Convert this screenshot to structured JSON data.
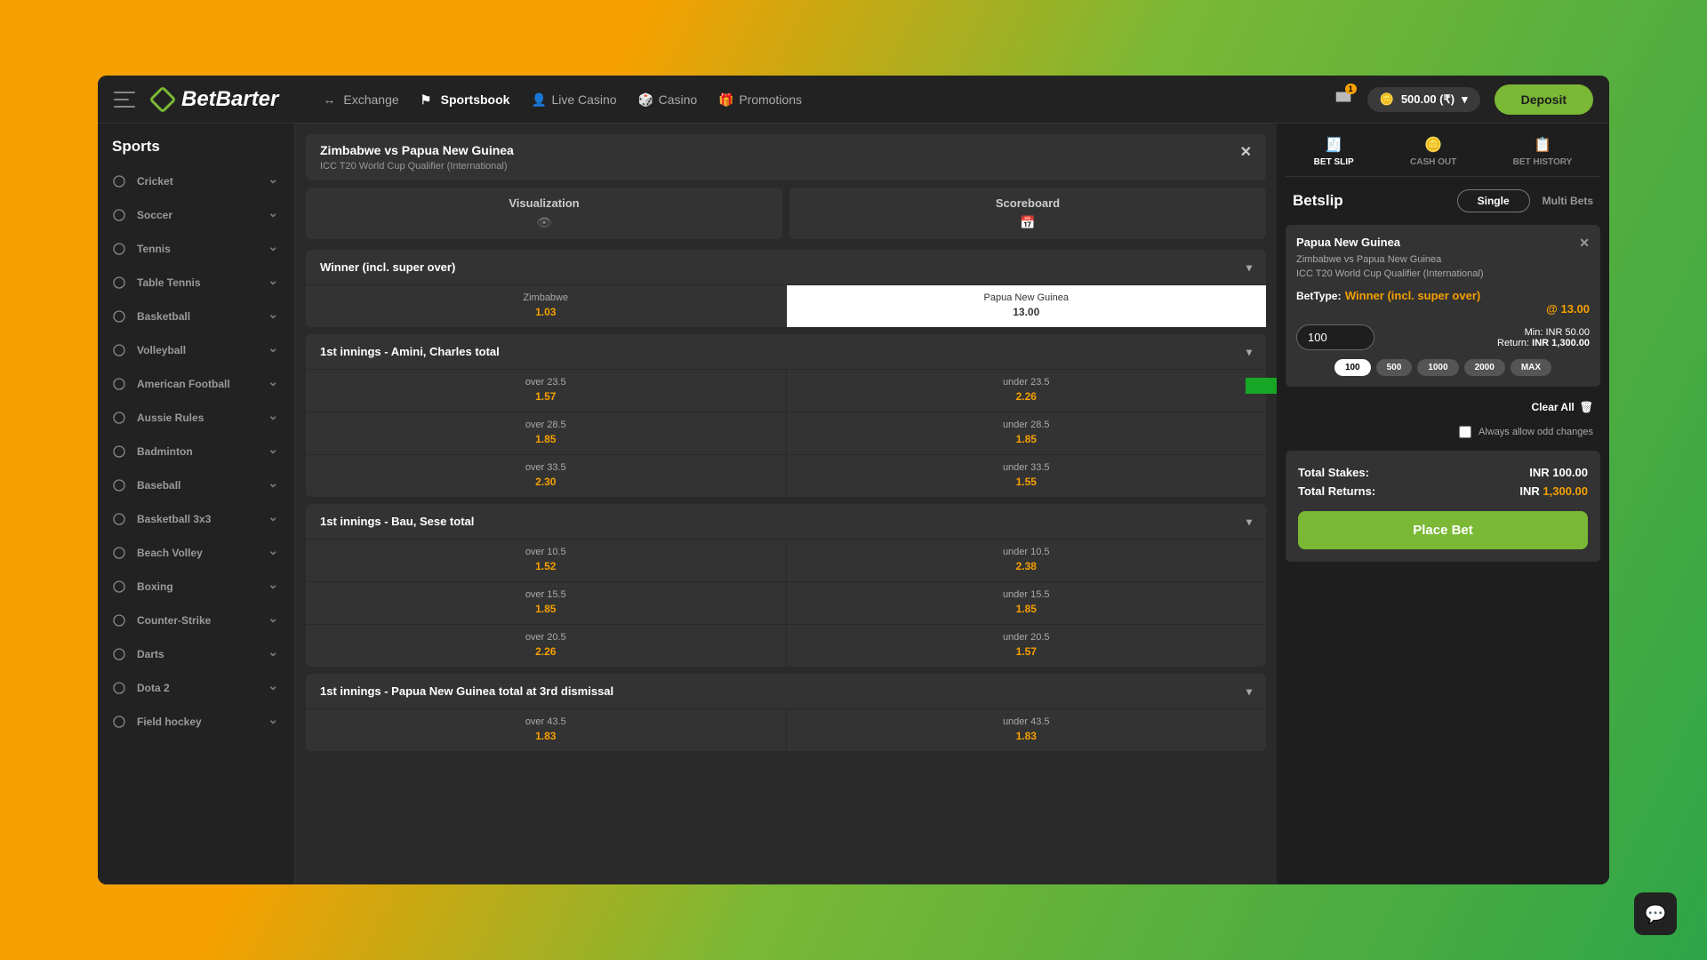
{
  "header": {
    "brand": "BetBarter",
    "nav": [
      {
        "label": "Exchange",
        "icon": "↔"
      },
      {
        "label": "Sportsbook",
        "icon": "⚑",
        "active": true
      },
      {
        "label": "Live Casino",
        "icon": "👤"
      },
      {
        "label": "Casino",
        "icon": "🎲"
      },
      {
        "label": "Promotions",
        "icon": "🎁"
      }
    ],
    "notif_count": "1",
    "balance": "500.00 (₹)",
    "deposit": "Deposit"
  },
  "sidebar": {
    "title": "Sports",
    "items": [
      "Cricket",
      "Soccer",
      "Tennis",
      "Table Tennis",
      "Basketball",
      "Volleyball",
      "American Football",
      "Aussie Rules",
      "Badminton",
      "Baseball",
      "Basketball 3x3",
      "Beach Volley",
      "Boxing",
      "Counter-Strike",
      "Darts",
      "Dota 2",
      "Field hockey"
    ]
  },
  "event": {
    "title": "Zimbabwe vs Papua New Guinea",
    "sub": "ICC T20 World Cup Qualifier (International)",
    "view_tabs": [
      "Visualization",
      "Scoreboard"
    ]
  },
  "markets": [
    {
      "title": "Winner (incl. super over)",
      "rows": [
        [
          {
            "name": "Zimbabwe",
            "val": "1.03"
          },
          {
            "name": "Papua New Guinea",
            "val": "13.00",
            "selected": true
          }
        ]
      ]
    },
    {
      "title": "1st innings - Amini, Charles total",
      "rows": [
        [
          {
            "name": "over 23.5",
            "val": "1.57"
          },
          {
            "name": "under 23.5",
            "val": "2.26"
          }
        ],
        [
          {
            "name": "over 28.5",
            "val": "1.85"
          },
          {
            "name": "under 28.5",
            "val": "1.85"
          }
        ],
        [
          {
            "name": "over 33.5",
            "val": "2.30"
          },
          {
            "name": "under 33.5",
            "val": "1.55"
          }
        ]
      ]
    },
    {
      "title": "1st innings - Bau, Sese total",
      "rows": [
        [
          {
            "name": "over 10.5",
            "val": "1.52"
          },
          {
            "name": "under 10.5",
            "val": "2.38"
          }
        ],
        [
          {
            "name": "over 15.5",
            "val": "1.85"
          },
          {
            "name": "under 15.5",
            "val": "1.85"
          }
        ],
        [
          {
            "name": "over 20.5",
            "val": "2.26"
          },
          {
            "name": "under 20.5",
            "val": "1.57"
          }
        ]
      ]
    },
    {
      "title": "1st innings - Papua New Guinea total at 3rd dismissal",
      "rows": [
        [
          {
            "name": "over 43.5",
            "val": "1.83"
          },
          {
            "name": "under 43.5",
            "val": "1.83"
          }
        ]
      ]
    }
  ],
  "slip": {
    "tabs": [
      "BET SLIP",
      "CASH OUT",
      "BET HISTORY"
    ],
    "title": "Betslip",
    "mode_single": "Single",
    "mode_multi": "Multi Bets",
    "bet": {
      "selection": "Papua New Guinea",
      "event": "Zimbabwe vs Papua New Guinea",
      "league": "ICC T20 World Cup Qualifier (International)",
      "type_label": "BetType:",
      "type_value": "Winner (incl. super over)",
      "odds": "@ 13.00",
      "stake": "100",
      "min": "Min: INR 50.00",
      "return_label": "Return:",
      "return": "INR 1,300.00"
    },
    "quick": [
      "100",
      "500",
      "1000",
      "2000",
      "MAX"
    ],
    "clear_all": "Clear All",
    "allow_odds": "Always allow odd changes",
    "totals": {
      "stakes_label": "Total Stakes:",
      "stakes": "INR 100.00",
      "returns_label": "Total Returns:",
      "returns_prefix": "INR ",
      "returns": "1,300.00"
    },
    "place": "Place Bet"
  }
}
